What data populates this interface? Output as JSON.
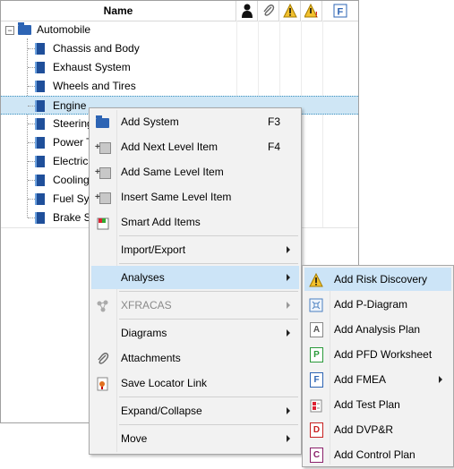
{
  "header": {
    "name_col": "Name",
    "icons": [
      "person-icon",
      "paperclip-icon",
      "warning-icon",
      "warning-exclaim-icon",
      "fmea-f-icon"
    ]
  },
  "tree": {
    "root": "Automobile",
    "children": [
      "Chassis and Body",
      "Exhaust System",
      "Wheels and Tires",
      "Engine",
      "Steering",
      "Power T",
      "Electrica",
      "Cooling",
      "Fuel Sys",
      "Brake Sy"
    ],
    "selected": "Engine"
  },
  "context_menu": {
    "items": [
      {
        "label": "Add System",
        "shortcut": "F3",
        "icon": "folder-icon"
      },
      {
        "label": "Add Next Level Item",
        "shortcut": "F4",
        "icon": "add-child-icon"
      },
      {
        "label": "Add Same Level Item",
        "icon": "add-sibling-icon"
      },
      {
        "label": "Insert Same Level Item",
        "icon": "insert-sibling-icon"
      },
      {
        "label": "Smart Add Items",
        "icon": "smart-add-icon"
      },
      {
        "label": "Import/Export",
        "submenu": true
      },
      {
        "label": "Analyses",
        "submenu": true,
        "highlighted": true
      },
      {
        "label": "XFRACAS",
        "submenu": true,
        "disabled": true,
        "icon": "xfracas-icon"
      },
      {
        "label": "Diagrams",
        "submenu": true
      },
      {
        "label": "Attachments",
        "icon": "paperclip-icon"
      },
      {
        "label": "Save Locator Link",
        "icon": "locator-icon"
      },
      {
        "label": "Expand/Collapse",
        "submenu": true
      },
      {
        "label": "Move",
        "submenu": true
      }
    ]
  },
  "submenu": {
    "items": [
      {
        "label": "Add Risk Discovery",
        "icon": "warning-icon",
        "highlighted": true
      },
      {
        "label": "Add P-Diagram",
        "icon": "p-diagram-icon"
      },
      {
        "label": "Add Analysis Plan",
        "icon": "analysis-plan-icon",
        "letter": "A"
      },
      {
        "label": "Add PFD Worksheet",
        "icon": "pfd-icon",
        "letter": "P"
      },
      {
        "label": "Add FMEA",
        "icon": "fmea-icon",
        "letter": "F",
        "submenu": true
      },
      {
        "label": "Add Test Plan",
        "icon": "test-plan-icon"
      },
      {
        "label": "Add DVP&R",
        "icon": "dvpr-icon",
        "letter": "D"
      },
      {
        "label": "Add Control Plan",
        "icon": "control-plan-icon",
        "letter": "C"
      }
    ]
  },
  "colors": {
    "selection": "#cfe6f5",
    "menu_bg": "#f2f2f2",
    "menu_highlight": "#cce4f7",
    "book_blue": "#1f4f9a"
  }
}
